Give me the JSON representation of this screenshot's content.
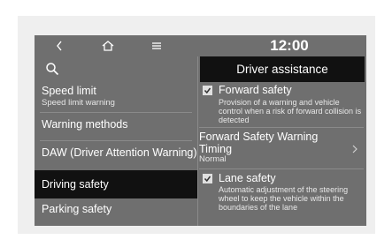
{
  "topbar": {
    "back_icon": "chevron-left-icon",
    "home_icon": "home-icon",
    "menu_icon": "menu-icon",
    "time": "12:00"
  },
  "left_menu": {
    "search_icon": "search-icon",
    "items": [
      {
        "title": "Speed limit",
        "subtitle": "Speed limit warning"
      },
      {
        "title": "Warning methods"
      },
      {
        "title": "DAW (Driver Attention Warning)"
      },
      {
        "title": "Driving safety",
        "selected": true
      },
      {
        "title": "Parking safety"
      }
    ]
  },
  "right_panel": {
    "header": "Driver assistance",
    "forward_safety": {
      "label": "Forward safety",
      "checked": true,
      "description": "Provision of a warning and vehicle control when a risk of forward collision is detected"
    },
    "fsw_timing": {
      "label": "Forward Safety Warning Timing",
      "value": "Normal"
    },
    "lane_safety": {
      "label": "Lane safety",
      "checked": true,
      "description": "Automatic adjustment of the steering wheel to keep the vehicle within the boundaries of the lane"
    }
  },
  "colors": {
    "screen_bg": "#6f6f6f",
    "highlight_bg": "#111111",
    "text": "#ffffff"
  }
}
